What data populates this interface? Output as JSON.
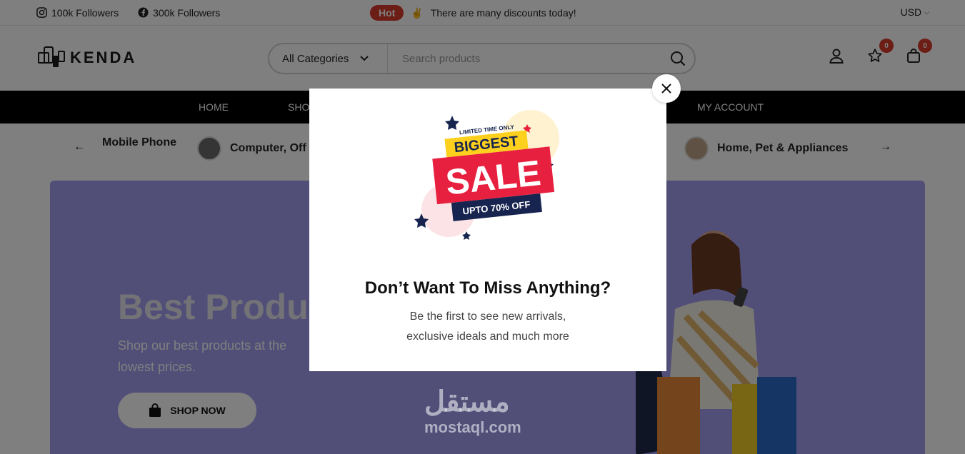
{
  "topbar": {
    "instagram_followers": "100k Followers",
    "facebook_followers": "300k Followers",
    "hot_badge": "Hot",
    "announcement_emoji": "✌",
    "announcement": "There are many discounts today!",
    "currency": "USD"
  },
  "header": {
    "logo_text": "KENDA",
    "category_select": "All Categories",
    "search_placeholder": "Search products",
    "wishlist_count": "0",
    "cart_count": "0"
  },
  "nav": {
    "items": [
      "HOME",
      "SHO",
      "MY ACCOUNT"
    ]
  },
  "categories": {
    "items": [
      "Mobile Phone",
      "Computer, Off",
      "Home, Pet & Appliances"
    ]
  },
  "hero": {
    "title": "Best Produc",
    "subtitle": "Shop our best products at the lowest prices.",
    "button_label": "SHOP NOW"
  },
  "modal": {
    "badge_top": "LIMITED TIME ONLY",
    "badge_biggest": "BIGGEST",
    "badge_sale": "SALE",
    "badge_offer": "UPTO 70% OFF",
    "title": "Don’t Want To Miss Anything?",
    "line1": "Be the first to see new arrivals,",
    "line2": "exclusive ideals and much more"
  },
  "watermark": {
    "arabic": "مستقل",
    "latin": "mostaql.com"
  },
  "colors": {
    "hot_red": "#d93a2b",
    "hero_purple": "#a39cf0",
    "nav_black": "#000000",
    "sale_red": "#e8203f",
    "sale_yellow": "#fdd01e",
    "sale_navy": "#16244f"
  }
}
